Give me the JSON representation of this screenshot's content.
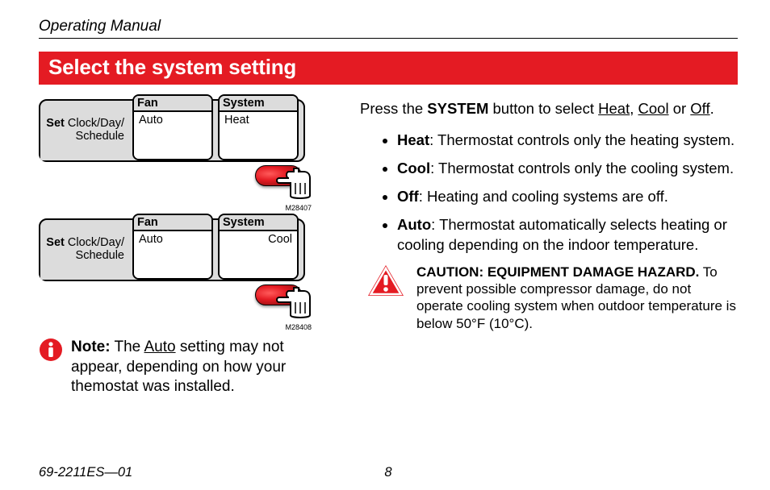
{
  "header": "Operating Manual",
  "title": "Select the system setting",
  "panel": {
    "set_label_bold": "Set",
    "set_label_rest": " Clock/Day/",
    "set_label_line2": "Schedule",
    "fan_label": "Fan",
    "fan_value": "Auto",
    "system_label": "System",
    "system_value_heat": "Heat",
    "system_value_cool": "Cool"
  },
  "codes": {
    "a": "M28407",
    "b": "M28408"
  },
  "note": {
    "bold": "Note:",
    "text1": " The ",
    "underline": "Auto",
    "text2": " setting may not appear, depending on how your themostat was installed."
  },
  "intro": {
    "t1": "Press the ",
    "b1": "SYSTEM",
    "t2": " button to select ",
    "u1": "Heat",
    "c1": ", ",
    "u2": "Cool",
    "t3": " or ",
    "u3": "Off",
    "t4": "."
  },
  "bullets": [
    {
      "b": "Heat",
      "t": ": Thermostat controls only the heating system."
    },
    {
      "b": "Cool",
      "t": ": Thermostat controls only the cooling system."
    },
    {
      "b": "Off",
      "t": ": Heating and cooling systems are off."
    },
    {
      "b": "Auto",
      "t": ": Thermostat automatically selects heating or cooling depending on the indoor temperature."
    }
  ],
  "caution": {
    "b": "CAUTION: EQUIPMENT DAMAGE HAZARD.",
    "t": " To prevent possible compressor damage, do not operate cooling system when outdoor temperature is below 50°F (10°C)."
  },
  "footer": {
    "doc": "69-2211ES—01",
    "page": "8"
  }
}
